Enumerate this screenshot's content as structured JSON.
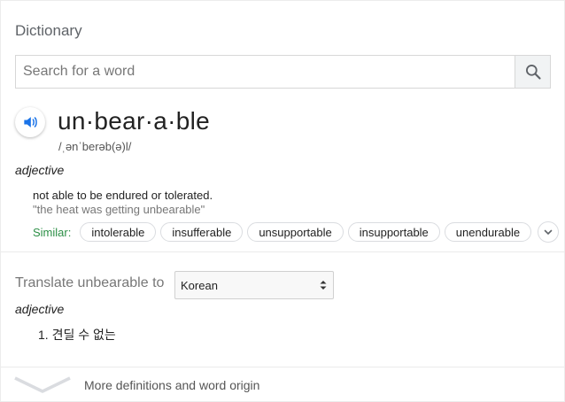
{
  "header": {
    "title": "Dictionary"
  },
  "search": {
    "placeholder": "Search for a word",
    "value": ""
  },
  "entry": {
    "headword": "un·bear·a·ble",
    "phonetic": "/ˌənˈberəb(ə)l/",
    "part_of_speech": "adjective",
    "definition": "not able to be endured or tolerated.",
    "example": "\"the heat was getting unbearable\"",
    "similar_label": "Similar:",
    "similar": [
      "intolerable",
      "insufferable",
      "unsupportable",
      "insupportable",
      "unendurable"
    ]
  },
  "translate": {
    "label": "Translate unbearable to",
    "selected_language": "Korean",
    "part_of_speech": "adjective",
    "items": [
      "1. 견딜 수 없는"
    ]
  },
  "footer": {
    "more_label": "More definitions and word origin"
  },
  "icons": {
    "search": "search-icon",
    "audio": "speaker-icon",
    "expand": "chevron-down-icon",
    "select": "select-arrows-icon",
    "footer": "chevron-down-icon"
  },
  "colors": {
    "accent": "#1a73e8",
    "similar_label": "#2c8f46"
  }
}
